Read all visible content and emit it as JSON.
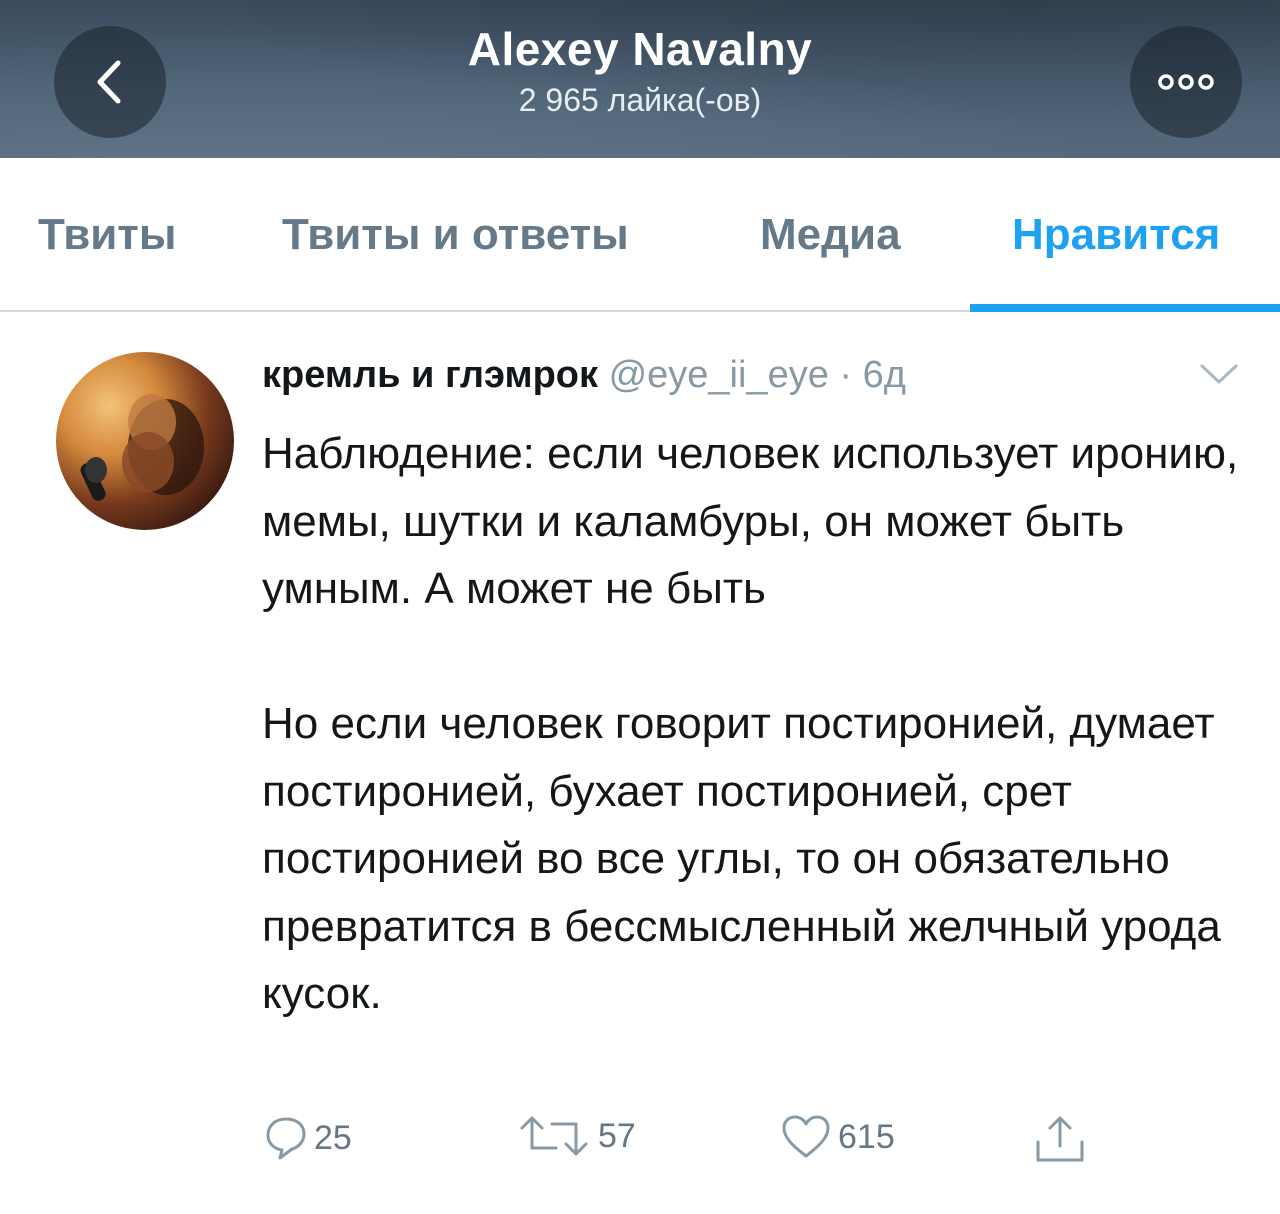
{
  "header": {
    "title": "Alexey Navalny",
    "subtitle": "2 965 лайка(-ов)",
    "back_icon": "chevron-left-icon",
    "more_icon": "more-dots-icon"
  },
  "tabs": [
    {
      "label": "Твиты",
      "active": false
    },
    {
      "label": "Твиты и ответы",
      "active": false
    },
    {
      "label": "Медиа",
      "active": false
    },
    {
      "label": "Нравится",
      "active": true
    }
  ],
  "tweet": {
    "author_name": "кремль и глэмрок",
    "handle": "@eye_ii_eye",
    "time": "· 6д",
    "text": "Наблюдение: если человек использует иронию, мемы, шутки и каламбуры, он может быть умным. А может не быть\n\nНо если человек говорит постиронией, думает постиронией, бухает постиронией, срет постиронией во все углы, то он обязательно превратится в бессмысленный желчный урода кусок.",
    "replies": "25",
    "retweets": "57",
    "likes": "615"
  },
  "colors": {
    "accent": "#1da1f2",
    "text_primary": "#14171a",
    "text_secondary": "#8899a6"
  }
}
